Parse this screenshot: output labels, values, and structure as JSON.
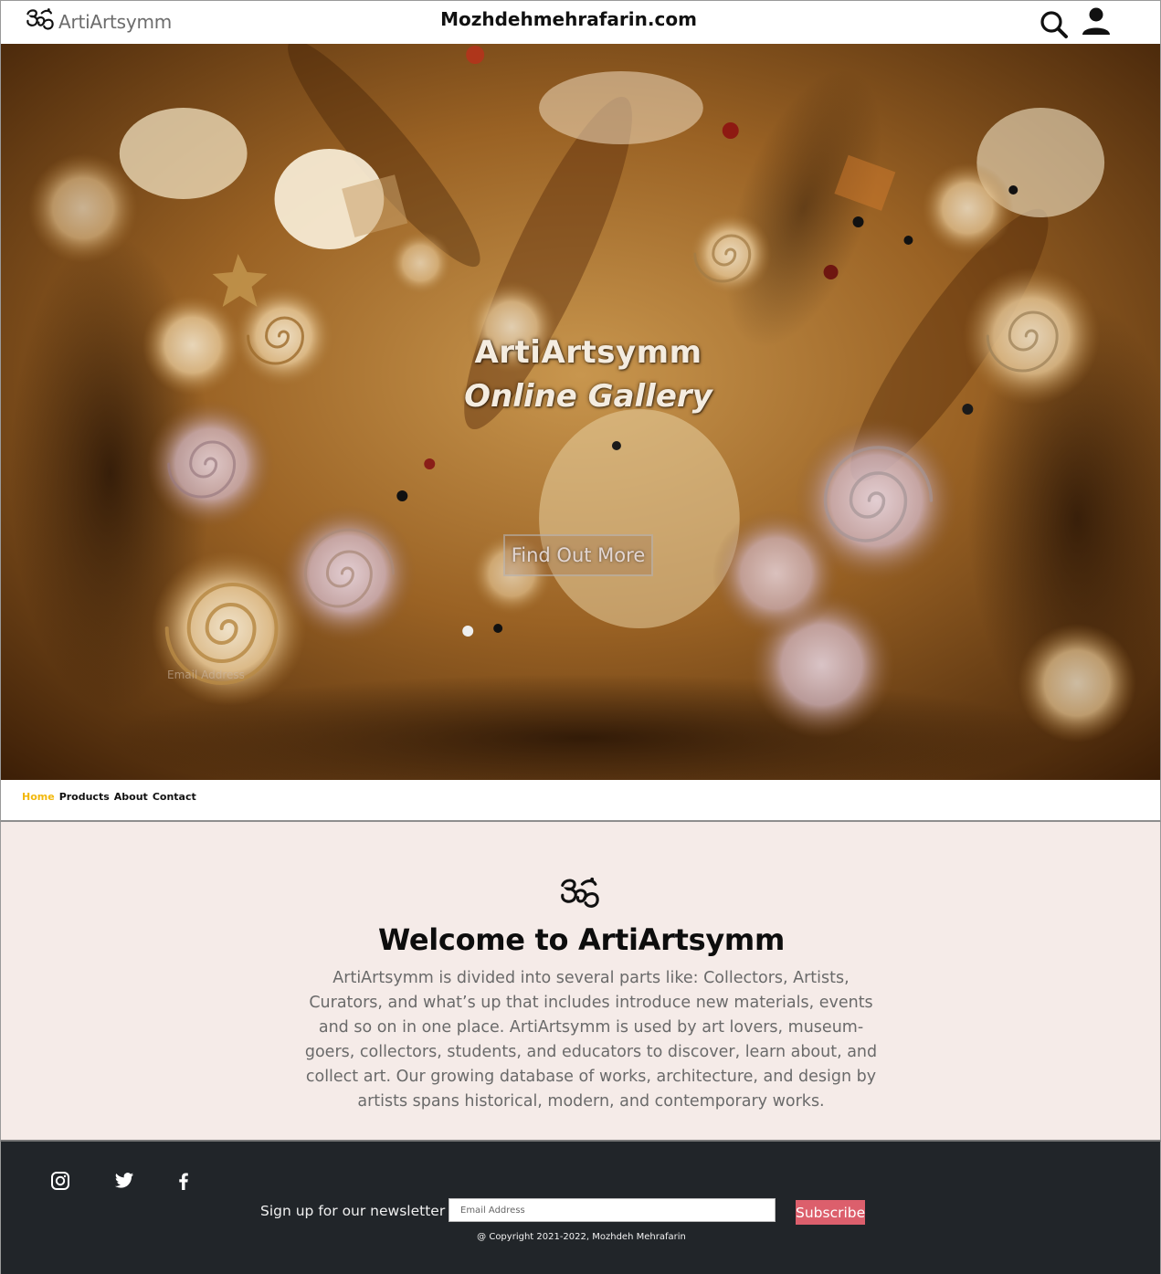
{
  "header": {
    "brand_name": "ArtiArtsymm",
    "site_title": "Mozhdehmehrafarin.com",
    "icons": [
      "om-logo-icon",
      "search-icon",
      "user-icon"
    ]
  },
  "hero": {
    "title": "ArtiArtsymm",
    "subtitle": "Online Gallery",
    "cta_label": "Find Out More",
    "email_placeholder": "Email Address"
  },
  "nav": {
    "links": [
      {
        "label": "Home",
        "active": true
      },
      {
        "label": "Products",
        "active": false
      },
      {
        "label": "About",
        "active": false
      },
      {
        "label": "Contact",
        "active": false
      }
    ],
    "active_color": "#f2b80c"
  },
  "welcome": {
    "title": "Welcome to ArtiArtsymm",
    "body": "ArtiArtsymm is divided into several parts like: Collectors, Artists, Curators, and what’s up that includes introduce new materials, events and so on in one place. ArtiArtsymm is used by art lovers, museum-goers, collectors, students, and educators to discover, learn about, and collect art. Our growing database of works, architecture, and design by artists spans historical, modern, and contemporary works.",
    "background": "#f5ebe8"
  },
  "footer": {
    "social": [
      "instagram-icon",
      "twitter-icon",
      "facebook-icon"
    ],
    "newsletter_label": "Sign up for our newsletter",
    "email_placeholder": "Email Address",
    "subscribe_label": "Subscribe",
    "subscribe_color": "#dc5f6c",
    "copyright": "@ Copyright 2021-2022, Mozhdeh Mehrafarin",
    "background": "#212529"
  }
}
